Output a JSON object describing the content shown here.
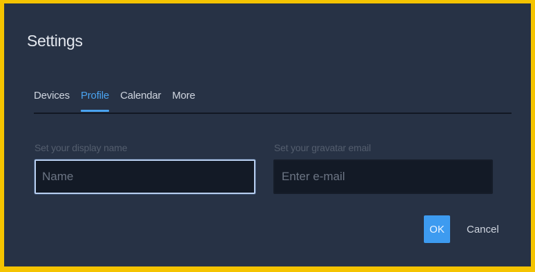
{
  "dialog": {
    "title": "Settings"
  },
  "tabs": [
    {
      "label": "Devices",
      "active": false
    },
    {
      "label": "Profile",
      "active": true
    },
    {
      "label": "Calendar",
      "active": false
    },
    {
      "label": "More",
      "active": false
    }
  ],
  "profile": {
    "display_name": {
      "label": "Set your display name",
      "placeholder": "Name",
      "value": ""
    },
    "gravatar_email": {
      "label": "Set your gravatar email",
      "placeholder": "Enter e-mail",
      "value": ""
    }
  },
  "actions": {
    "ok_label": "OK",
    "cancel_label": "Cancel"
  },
  "colors": {
    "frame_border": "#f5c400",
    "dialog_background": "#273245",
    "accent": "#4aa3f0",
    "ok_button": "#3d9bf0"
  }
}
